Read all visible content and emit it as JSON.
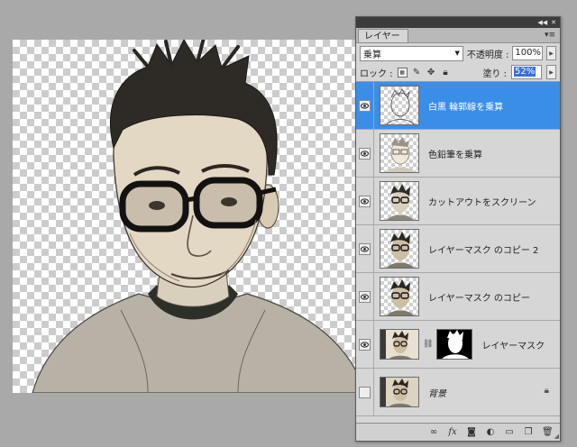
{
  "canvas": {
    "background": "transparent-checkerboard"
  },
  "panel": {
    "tab": "レイヤー",
    "titlebar_buttons": [
      "collapse-icon",
      "close-icon"
    ],
    "menu_icon": "panel-menu-icon",
    "blend_mode": "乗算",
    "opacity_label": "不透明度 :",
    "opacity_value": "100%",
    "lock_label": "ロック :",
    "lock_icons": [
      "lock-transparent-icon",
      "lock-paint-icon",
      "lock-move-icon",
      "lock-all-icon"
    ],
    "fill_label": "塗り :",
    "fill_value": "52%"
  },
  "layers": [
    {
      "name": "白黒 輪郭線を乗算",
      "visible": true,
      "selected": true,
      "thumb": "sketch"
    },
    {
      "name": "色鉛筆を乗算",
      "visible": true,
      "selected": false,
      "thumb": "pencil"
    },
    {
      "name": "カットアウトをスクリーン",
      "visible": true,
      "selected": false,
      "thumb": "cutout"
    },
    {
      "name": "レイヤーマスク のコピー 2",
      "visible": true,
      "selected": false,
      "thumb": "photo"
    },
    {
      "name": "レイヤーマスク のコピー",
      "visible": true,
      "selected": false,
      "thumb": "photo"
    },
    {
      "name": "レイヤーマスク",
      "visible": true,
      "selected": false,
      "thumb": "photo",
      "has_mask": true
    },
    {
      "name": "背景",
      "visible": false,
      "selected": false,
      "thumb": "photo",
      "locked": true,
      "italic": true
    }
  ],
  "bottom_icons": [
    "link-icon",
    "fx-icon",
    "add-mask-icon",
    "adjustment-icon",
    "group-folder-icon",
    "new-layer-icon",
    "trash-icon"
  ],
  "colors": {
    "selection": "#3a8ee8",
    "panel_bg": "#d6d6d6",
    "workspace": "#a9a9a9"
  }
}
